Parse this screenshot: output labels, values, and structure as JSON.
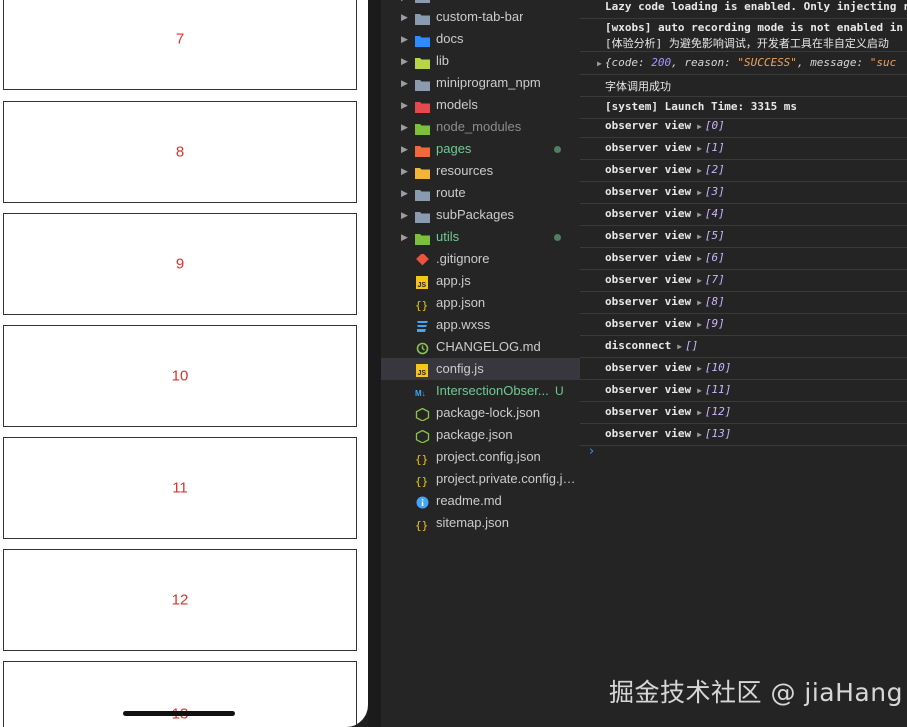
{
  "phone": {
    "cards": [
      "7",
      "8",
      "9",
      "10",
      "11",
      "12",
      "13"
    ]
  },
  "explorer": {
    "items": [
      {
        "label": "custom-tab-bar",
        "type": "folder",
        "color": "#8a9bb0",
        "style": ""
      },
      {
        "label": "docs",
        "type": "folder",
        "color": "#2f8cff",
        "style": ""
      },
      {
        "label": "lib",
        "type": "folder",
        "color": "#b8d44a",
        "style": ""
      },
      {
        "label": "miniprogram_npm",
        "type": "folder",
        "color": "#8a9bb0",
        "style": ""
      },
      {
        "label": "models",
        "type": "folder",
        "color": "#e5484d",
        "style": ""
      },
      {
        "label": "node_modules",
        "type": "folder",
        "color": "#7bbf3d",
        "style": "dim"
      },
      {
        "label": "pages",
        "type": "folder",
        "color": "#f0693a",
        "style": "green",
        "modified": true
      },
      {
        "label": "resources",
        "type": "folder",
        "color": "#f2b53a",
        "style": ""
      },
      {
        "label": "route",
        "type": "folder",
        "color": "#8a9bb0",
        "style": ""
      },
      {
        "label": "subPackages",
        "type": "folder",
        "color": "#8a9bb0",
        "style": ""
      },
      {
        "label": "utils",
        "type": "folder",
        "color": "#7bbf3d",
        "style": "green",
        "modified": true
      },
      {
        "label": ".gitignore",
        "type": "git",
        "color": "#e8553c",
        "style": ""
      },
      {
        "label": "app.js",
        "type": "js",
        "color": "#f5c518",
        "style": ""
      },
      {
        "label": "app.json",
        "type": "json",
        "color": "#f5c518",
        "style": ""
      },
      {
        "label": "app.wxss",
        "type": "css",
        "color": "#42a5f5",
        "style": ""
      },
      {
        "label": "CHANGELOG.md",
        "type": "changelog",
        "color": "#8bc34a",
        "style": ""
      },
      {
        "label": "config.js",
        "type": "js",
        "color": "#f5c518",
        "style": "",
        "selected": true
      },
      {
        "label": "IntersectionObser...",
        "type": "md",
        "color": "#42a5f5",
        "style": "green",
        "badge": "U"
      },
      {
        "label": "package-lock.json",
        "type": "npm",
        "color": "#8bc34a",
        "style": ""
      },
      {
        "label": "package.json",
        "type": "npm",
        "color": "#8bc34a",
        "style": ""
      },
      {
        "label": "project.config.json",
        "type": "json",
        "color": "#f5c518",
        "style": ""
      },
      {
        "label": "project.private.config.js...",
        "type": "json",
        "color": "#f5c518",
        "style": ""
      },
      {
        "label": "readme.md",
        "type": "info",
        "color": "#42a5f5",
        "style": ""
      },
      {
        "label": "sitemap.json",
        "type": "json",
        "color": "#f5c518",
        "style": ""
      }
    ]
  },
  "console": {
    "header1": "Lazy code loading is enabled. Only injecting r",
    "header2a": "[wxobs] auto recording mode is not enabled in",
    "header2b": "[体验分析] 为避免影响调试，开发者工具在非自定义启动",
    "obj": {
      "code_key": "code",
      "code_val": "200",
      "reason_key": "reason",
      "reason_val": "\"SUCCESS\"",
      "message_key": "message",
      "message_val": "\"suc"
    },
    "font_ok": "字体调用成功",
    "launch": "[system] Launch Time: 3315 ms",
    "logs": [
      {
        "label": "observer view",
        "value": "[0]"
      },
      {
        "label": "observer view",
        "value": "[1]"
      },
      {
        "label": "observer view",
        "value": "[2]"
      },
      {
        "label": "observer view",
        "value": "[3]"
      },
      {
        "label": "observer view",
        "value": "[4]"
      },
      {
        "label": "observer view",
        "value": "[5]"
      },
      {
        "label": "observer view",
        "value": "[6]"
      },
      {
        "label": "observer view",
        "value": "[7]"
      },
      {
        "label": "observer view",
        "value": "[8]"
      },
      {
        "label": "observer view",
        "value": "[9]"
      },
      {
        "label": "disconnect",
        "value": "[]"
      },
      {
        "label": "observer view",
        "value": "[10]"
      },
      {
        "label": "observer view",
        "value": "[11]"
      },
      {
        "label": "observer view",
        "value": "[12]"
      },
      {
        "label": "observer view",
        "value": "[13]"
      }
    ],
    "prompt": "›"
  },
  "watermark": "掘金技术社区 @ jiaHang"
}
